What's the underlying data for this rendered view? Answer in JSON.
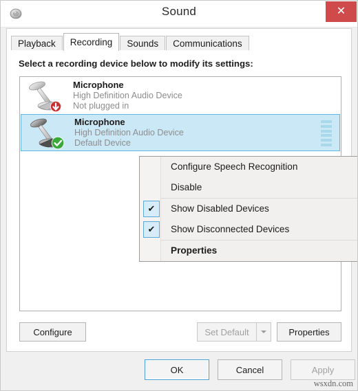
{
  "window": {
    "title": "Sound",
    "app_icon": "speaker-icon",
    "close_label": "✕"
  },
  "tabs": [
    {
      "label": "Playback",
      "active": false
    },
    {
      "label": "Recording",
      "active": true
    },
    {
      "label": "Sounds",
      "active": false
    },
    {
      "label": "Communications",
      "active": false
    }
  ],
  "page": {
    "hint": "Select a recording device below to modify its settings:",
    "devices": [
      {
        "name": "Microphone",
        "driver": "High Definition Audio Device",
        "status": "Not plugged in",
        "badge": "down-arrow-badge",
        "selected": false,
        "has_meter": false
      },
      {
        "name": "Microphone",
        "driver": "High Definition Audio Device",
        "status": "Default Device",
        "badge": "green-check-badge",
        "selected": true,
        "has_meter": true
      }
    ],
    "buttons": {
      "configure": "Configure",
      "set_default": "Set Default",
      "set_default_disabled": true,
      "properties": "Properties"
    }
  },
  "footer": {
    "ok": "OK",
    "cancel": "Cancel",
    "apply": "Apply",
    "apply_disabled": true,
    "watermark": "wsxdn.com"
  },
  "context_menu": {
    "items": [
      {
        "label": "Configure Speech Recognition",
        "checked": false,
        "bold": false
      },
      {
        "label": "Disable",
        "checked": false,
        "bold": false
      },
      {
        "label": "Show Disabled Devices",
        "checked": true,
        "bold": false
      },
      {
        "label": "Show Disconnected Devices",
        "checked": true,
        "bold": false
      },
      {
        "label": "Properties",
        "checked": false,
        "bold": true
      }
    ]
  },
  "colors": {
    "close_red": "#cf4a4a",
    "selection_blue": "#cbe8f6",
    "selection_border": "#5cb6e0",
    "focus_blue": "#4c9fd4",
    "check_badge_green": "#3aa93a",
    "unplugged_red": "#c7302f"
  }
}
